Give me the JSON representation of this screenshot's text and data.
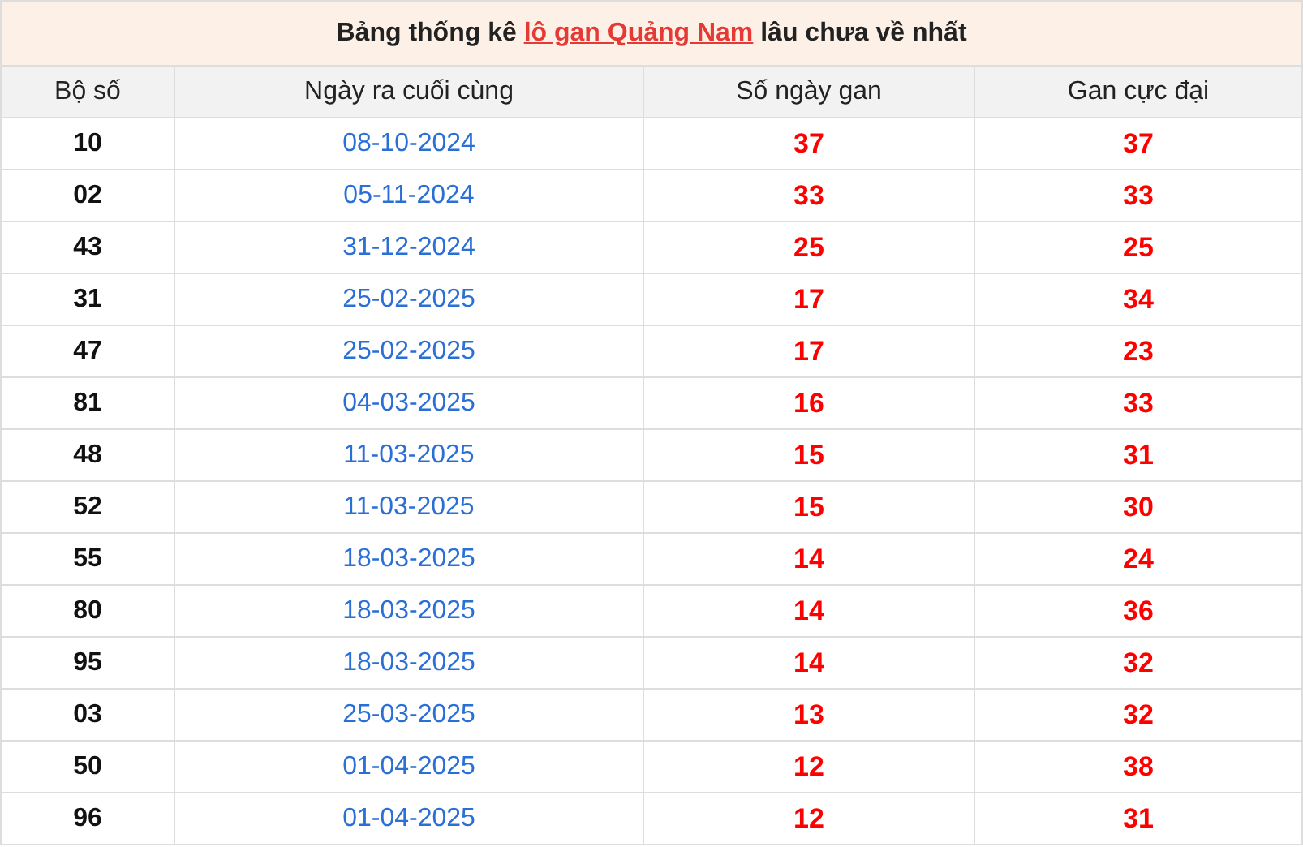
{
  "title": {
    "before": "Bảng thống kê ",
    "link": "lô gan Quảng Nam",
    "after": " lâu chưa về nhất"
  },
  "columns": [
    "Bộ số",
    "Ngày ra cuối cùng",
    "Số ngày gan",
    "Gan cực đại"
  ],
  "rows": [
    {
      "number": "10",
      "last_date": "08-10-2024",
      "days": "37",
      "max": "37"
    },
    {
      "number": "02",
      "last_date": "05-11-2024",
      "days": "33",
      "max": "33"
    },
    {
      "number": "43",
      "last_date": "31-12-2024",
      "days": "25",
      "max": "25"
    },
    {
      "number": "31",
      "last_date": "25-02-2025",
      "days": "17",
      "max": "34"
    },
    {
      "number": "47",
      "last_date": "25-02-2025",
      "days": "17",
      "max": "23"
    },
    {
      "number": "81",
      "last_date": "04-03-2025",
      "days": "16",
      "max": "33"
    },
    {
      "number": "48",
      "last_date": "11-03-2025",
      "days": "15",
      "max": "31"
    },
    {
      "number": "52",
      "last_date": "11-03-2025",
      "days": "15",
      "max": "30"
    },
    {
      "number": "55",
      "last_date": "18-03-2025",
      "days": "14",
      "max": "24"
    },
    {
      "number": "80",
      "last_date": "18-03-2025",
      "days": "14",
      "max": "36"
    },
    {
      "number": "95",
      "last_date": "18-03-2025",
      "days": "14",
      "max": "32"
    },
    {
      "number": "03",
      "last_date": "25-03-2025",
      "days": "13",
      "max": "32"
    },
    {
      "number": "50",
      "last_date": "01-04-2025",
      "days": "12",
      "max": "38"
    },
    {
      "number": "96",
      "last_date": "01-04-2025",
      "days": "12",
      "max": "31"
    }
  ]
}
